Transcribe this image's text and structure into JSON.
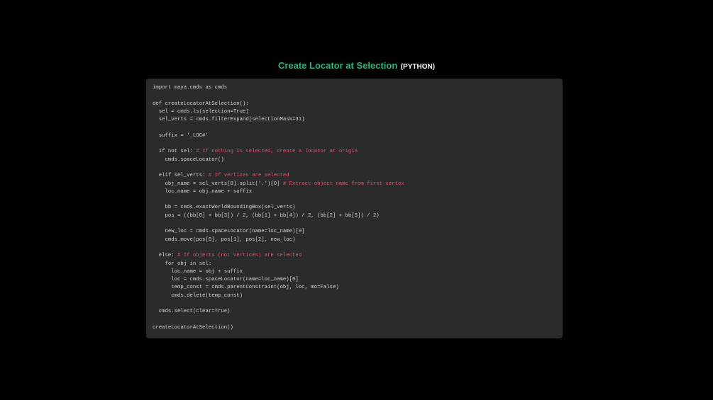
{
  "title": {
    "main": "Create Locator at Selection",
    "language": "(PYTHON)"
  },
  "colors": {
    "page_background": "#000000",
    "panel_background": "#2b2b2b",
    "title_accent": "#2fb37a",
    "code_text": "#d6d6d6",
    "code_comment": "#d9586e"
  },
  "code": {
    "lines": [
      {
        "text": "import maya.cmds as cmds",
        "comment": ""
      },
      {
        "text": "",
        "comment": ""
      },
      {
        "text": "def createLocatorAtSelection():",
        "comment": ""
      },
      {
        "text": "  sel = cmds.ls(selection=True)",
        "comment": ""
      },
      {
        "text": "  sel_verts = cmds.filterExpand(selectionMask=31)",
        "comment": ""
      },
      {
        "text": "",
        "comment": ""
      },
      {
        "text": "  suffix = '_LOC#'",
        "comment": ""
      },
      {
        "text": "",
        "comment": ""
      },
      {
        "text": "  if not sel: ",
        "comment": "# If nothing is selected, create a locator at origin"
      },
      {
        "text": "    cmds.spaceLocator()",
        "comment": ""
      },
      {
        "text": "",
        "comment": ""
      },
      {
        "text": "  elif sel_verts: ",
        "comment": "# If vertices are selected"
      },
      {
        "text": "    obj_name = sel_verts[0].split('.')[0] ",
        "comment": "# Extract object name from first vertex"
      },
      {
        "text": "    loc_name = obj_name + suffix",
        "comment": ""
      },
      {
        "text": "",
        "comment": ""
      },
      {
        "text": "    bb = cmds.exactWorldBoundingBox(sel_verts)",
        "comment": ""
      },
      {
        "text": "    pos = ((bb[0] + bb[3]) / 2, (bb[1] + bb[4]) / 2, (bb[2] + bb[5]) / 2)",
        "comment": ""
      },
      {
        "text": "",
        "comment": ""
      },
      {
        "text": "    new_loc = cmds.spaceLocator(name=loc_name)[0]",
        "comment": ""
      },
      {
        "text": "    cmds.move(pos[0], pos[1], pos[2], new_loc)",
        "comment": ""
      },
      {
        "text": "",
        "comment": ""
      },
      {
        "text": "  else: ",
        "comment": "# If objects (not vertices) are selected"
      },
      {
        "text": "    for obj in sel:",
        "comment": ""
      },
      {
        "text": "      loc_name = obj + suffix",
        "comment": ""
      },
      {
        "text": "      loc = cmds.spaceLocator(name=loc_name)[0]",
        "comment": ""
      },
      {
        "text": "      temp_const = cmds.parentConstraint(obj, loc, mo=False)",
        "comment": ""
      },
      {
        "text": "      cmds.delete(temp_const)",
        "comment": ""
      },
      {
        "text": "",
        "comment": ""
      },
      {
        "text": "  cmds.select(clear=True)",
        "comment": ""
      },
      {
        "text": "",
        "comment": ""
      },
      {
        "text": "createLocatorAtSelection()",
        "comment": ""
      }
    ]
  }
}
